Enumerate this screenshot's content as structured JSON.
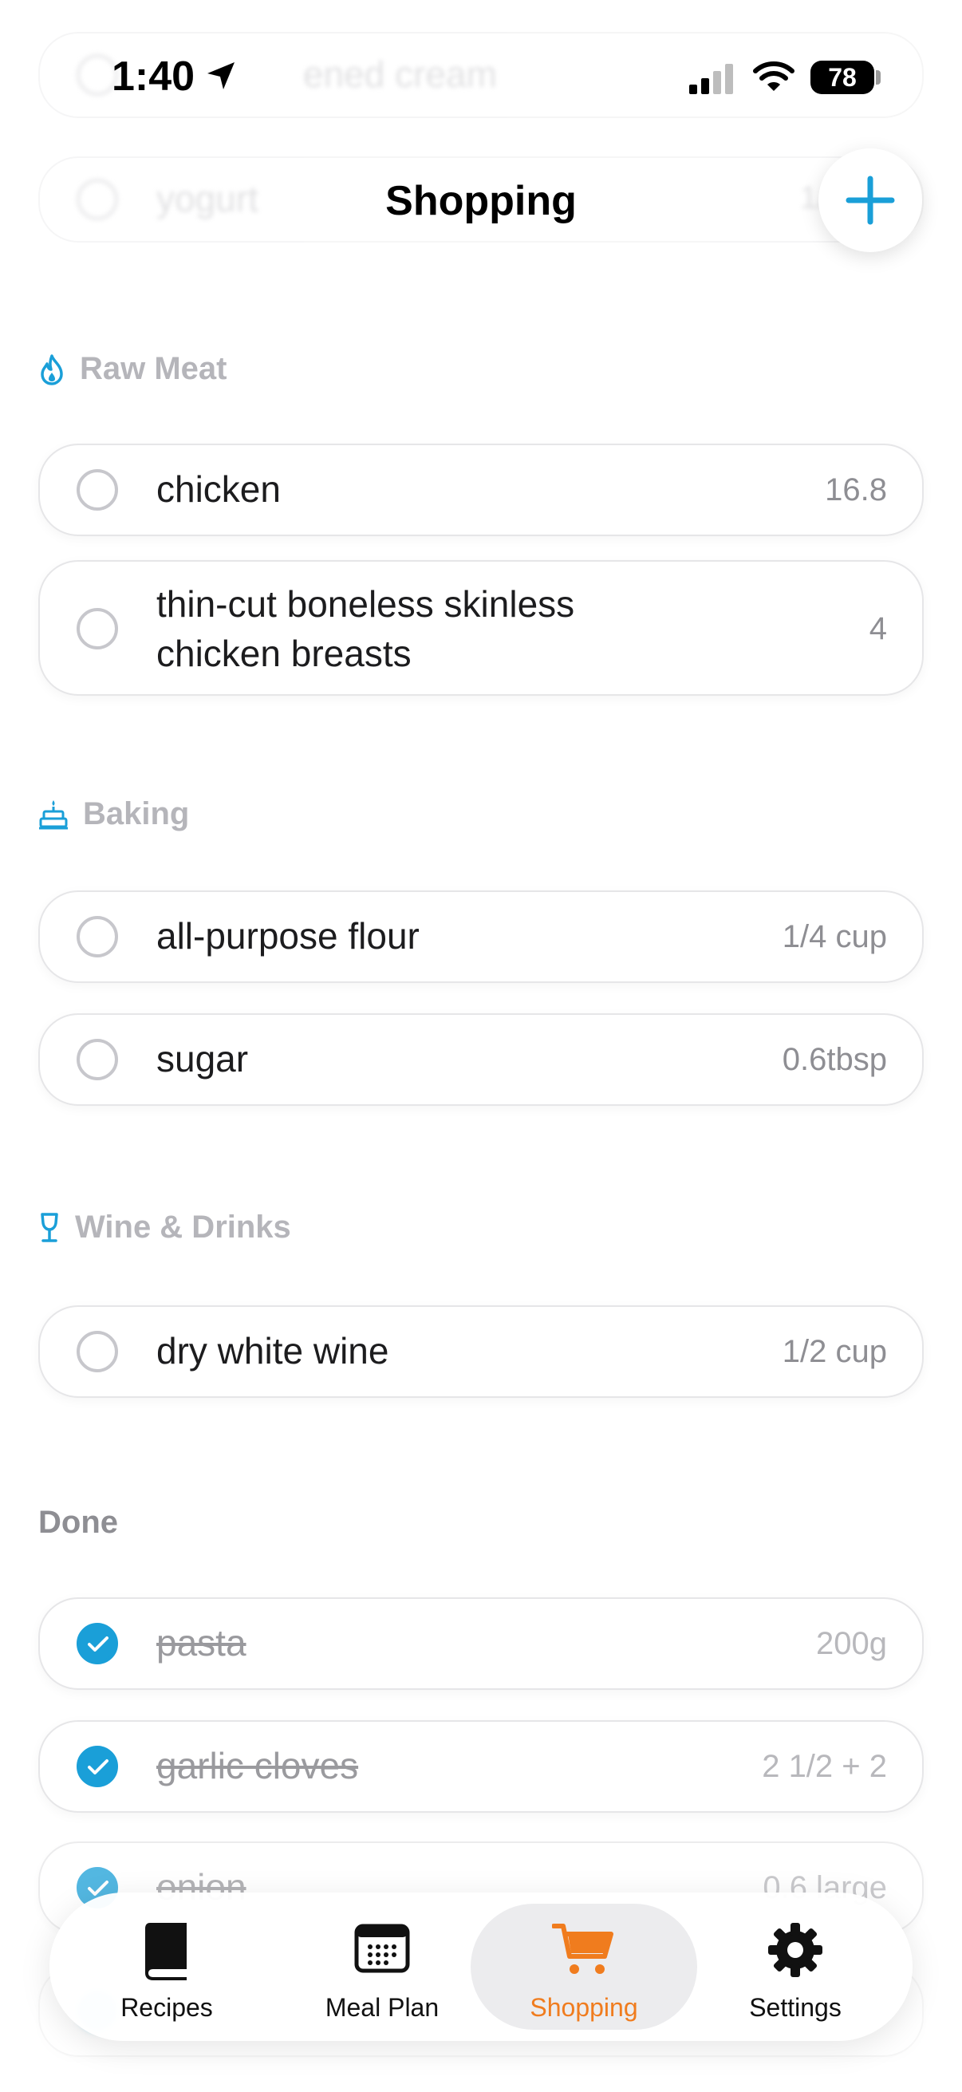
{
  "status_bar": {
    "time": "1:40",
    "battery": "78"
  },
  "header": {
    "title": "Shopping"
  },
  "ghost_rows": [
    {
      "name": "ened cream",
      "qty": ""
    },
    {
      "name": "yogurt",
      "qty": "1/"
    }
  ],
  "sections": [
    {
      "title": "Raw Meat",
      "icon": "flame-icon",
      "items": [
        {
          "name": "chicken",
          "qty": "16.8"
        },
        {
          "name_line1": "thin-cut boneless skinless",
          "name_line2": "chicken breasts",
          "qty": "4"
        }
      ]
    },
    {
      "title": "Baking",
      "icon": "cake-icon",
      "items": [
        {
          "name": "all-purpose flour",
          "qty": "1/4 cup"
        },
        {
          "name": "sugar",
          "qty": "0.6tbsp"
        }
      ]
    },
    {
      "title": "Wine & Drinks",
      "icon": "wine-glass-icon",
      "items": [
        {
          "name": "dry white wine",
          "qty": "1/2 cup"
        }
      ]
    }
  ],
  "done": {
    "title": "Done",
    "items": [
      {
        "name": "pasta",
        "qty": "200g"
      },
      {
        "name": "garlic cloves",
        "qty": "2 1/2 + 2"
      },
      {
        "name": "onion",
        "qty": "0.6 large"
      }
    ]
  },
  "tabs": [
    {
      "label": "Recipes",
      "icon": "book-icon"
    },
    {
      "label": "Meal Plan",
      "icon": "calendar-icon"
    },
    {
      "label": "Shopping",
      "icon": "cart-icon",
      "active": true
    },
    {
      "label": "Settings",
      "icon": "gear-icon"
    }
  ],
  "colors": {
    "accent_blue": "#1a9fd8",
    "active_orange": "#f07c1e"
  }
}
